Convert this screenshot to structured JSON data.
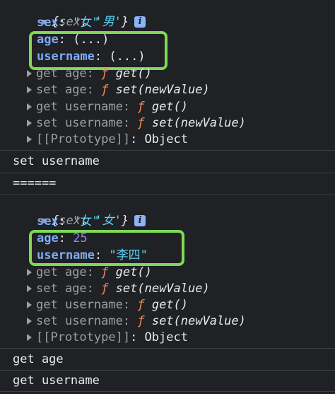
{
  "logs": [
    {
      "object_preview": {
        "open": "{",
        "key": "sex",
        "value": "'男'",
        "close": "}"
      },
      "props": [
        {
          "key": "sex",
          "value": "\"女\""
        },
        {
          "key": "age",
          "value": "(...)"
        },
        {
          "key": "username",
          "value": "(...)"
        }
      ],
      "accessors": [
        {
          "kind": "get",
          "name": "age",
          "fn": "ƒ",
          "sig": "get()"
        },
        {
          "kind": "set",
          "name": "age",
          "fn": "ƒ",
          "sig": "set(newValue)"
        },
        {
          "kind": "get",
          "name": "username",
          "fn": "ƒ",
          "sig": "get()"
        },
        {
          "kind": "set",
          "name": "username",
          "fn": "ƒ",
          "sig": "set(newValue)"
        }
      ],
      "prototype": {
        "label": "[[Prototype]]",
        "value": "Object"
      }
    },
    {
      "object_preview": {
        "open": "{",
        "key": "sex",
        "value": "'女'",
        "close": "}"
      },
      "props": [
        {
          "key": "sex",
          "value": "\"女\""
        },
        {
          "key": "age",
          "value": "25"
        },
        {
          "key": "username",
          "value": "\"李四\""
        }
      ],
      "accessors": [
        {
          "kind": "get",
          "name": "age",
          "fn": "ƒ",
          "sig": "get()"
        },
        {
          "kind": "set",
          "name": "age",
          "fn": "ƒ",
          "sig": "set(newValue)"
        },
        {
          "kind": "get",
          "name": "username",
          "fn": "ƒ",
          "sig": "get()"
        },
        {
          "kind": "set",
          "name": "username",
          "fn": "ƒ",
          "sig": "set(newValue)"
        }
      ],
      "prototype": {
        "label": "[[Prototype]]",
        "value": "Object"
      }
    }
  ],
  "messages": {
    "set_username": "set username",
    "divider": "======",
    "get_age": "get age",
    "get_username": "get username"
  },
  "info_icon": "i",
  "colors": {
    "highlight": "#7dd957",
    "background": "#202124"
  }
}
